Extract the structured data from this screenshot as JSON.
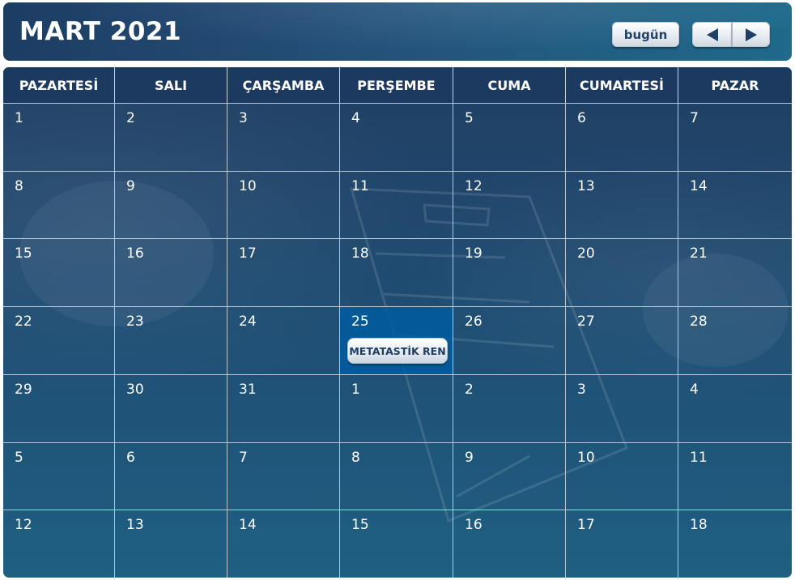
{
  "header": {
    "title": "MART 2021",
    "today_label": "bugün",
    "prev_icon": "arrow-left",
    "next_icon": "arrow-right"
  },
  "weekdays": [
    "PAZARTESİ",
    "SALI",
    "ÇARŞAMBA",
    "PERŞEMBE",
    "CUMA",
    "CUMARTESİ",
    "PAZAR"
  ],
  "weeks": [
    [
      "1",
      "2",
      "3",
      "4",
      "5",
      "6",
      "7"
    ],
    [
      "8",
      "9",
      "10",
      "11",
      "12",
      "13",
      "14"
    ],
    [
      "15",
      "16",
      "17",
      "18",
      "19",
      "20",
      "21"
    ],
    [
      "22",
      "23",
      "24",
      "25",
      "26",
      "27",
      "28"
    ],
    [
      "29",
      "30",
      "31",
      "1",
      "2",
      "3",
      "4"
    ],
    [
      "5",
      "6",
      "7",
      "8",
      "9",
      "10",
      "11"
    ],
    [
      "12",
      "13",
      "14",
      "15",
      "16",
      "17",
      "18"
    ]
  ],
  "highlighted_day": "25",
  "event": {
    "label": "METATASTİK REN"
  },
  "colors": {
    "header_bg": "#1d3d63",
    "today_cell": "#005ca0",
    "button_text": "#1d3d63",
    "grid_line": "#b8c6d3"
  }
}
